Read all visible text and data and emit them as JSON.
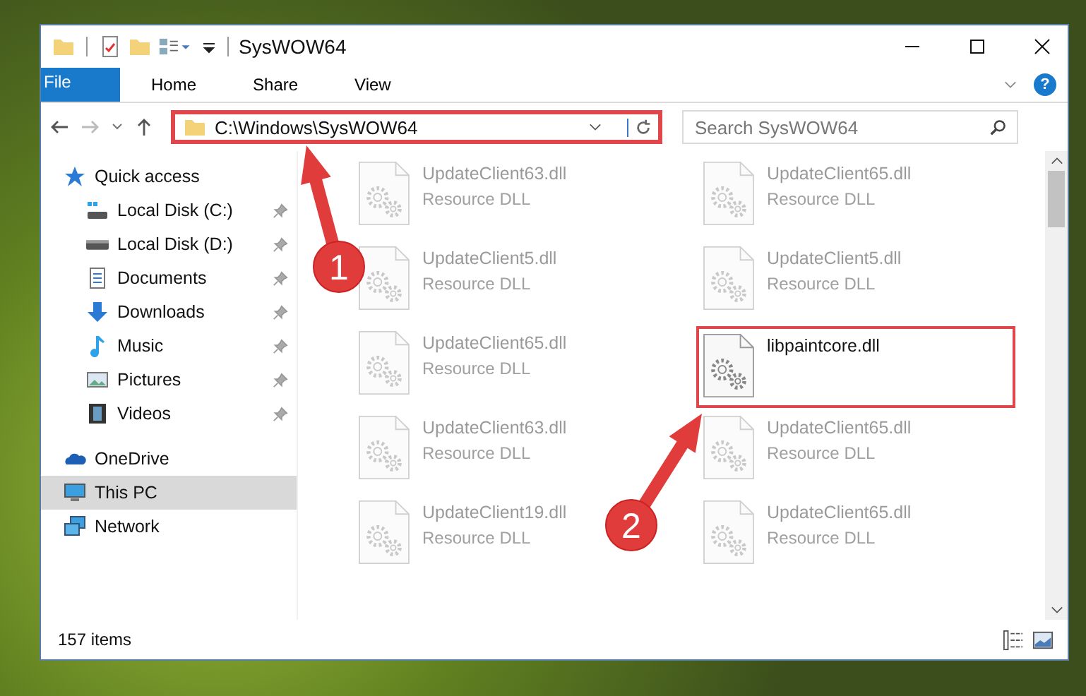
{
  "window": {
    "title": "SysWOW64"
  },
  "ribbon_tabs": [
    {
      "label": "File",
      "kind": "file"
    },
    {
      "label": "Home",
      "kind": "tab"
    },
    {
      "label": "Share",
      "kind": "tab"
    },
    {
      "label": "View",
      "kind": "tab"
    }
  ],
  "help_button": "?",
  "address_bar": {
    "path": "C:\\Windows\\SysWOW64",
    "highlighted": true
  },
  "search": {
    "placeholder": "Search SysWOW64"
  },
  "sidebar": {
    "items": [
      {
        "label": "Quick access",
        "kind": "star",
        "selected": false,
        "children": [
          {
            "label": "Local Disk (C:)",
            "kind": "system-drive",
            "pinned": true
          },
          {
            "label": "Local Disk (D:)",
            "kind": "drive",
            "pinned": true
          },
          {
            "label": "Documents",
            "kind": "documents",
            "pinned": true
          },
          {
            "label": "Downloads",
            "kind": "downloads",
            "pinned": true
          },
          {
            "label": "Music",
            "kind": "music",
            "pinned": true
          },
          {
            "label": "Pictures",
            "kind": "pictures",
            "pinned": true
          },
          {
            "label": "Videos",
            "kind": "videos",
            "pinned": true
          }
        ]
      },
      {
        "label": "OneDrive",
        "kind": "cloud",
        "selected": false
      },
      {
        "label": "This PC",
        "kind": "computer",
        "selected": true
      },
      {
        "label": "Network",
        "kind": "network",
        "selected": false
      }
    ]
  },
  "files": [
    {
      "name": "UpdateClient63.dll",
      "type": "Resource DLL",
      "faded": true,
      "highlighted": false
    },
    {
      "name": "UpdateClient65.dll",
      "type": "Resource DLL",
      "faded": true,
      "highlighted": false
    },
    {
      "name": "UpdateClient5.dll",
      "type": "Resource DLL",
      "faded": true,
      "highlighted": false
    },
    {
      "name": "UpdateClient5.dll",
      "type": "Resource DLL",
      "faded": true,
      "highlighted": false
    },
    {
      "name": "UpdateClient65.dll",
      "type": "Resource DLL",
      "faded": true,
      "highlighted": false
    },
    {
      "name": "libpaintcore.dll",
      "faded": false,
      "highlighted": true
    },
    {
      "name": "UpdateClient63.dll",
      "type": "Resource DLL",
      "faded": true,
      "highlighted": false
    },
    {
      "name": "UpdateClient65.dll",
      "type": "Resource DLL",
      "faded": true,
      "highlighted": false
    },
    {
      "name": "UpdateClient19.dll",
      "type": "Resource DLL",
      "faded": true,
      "highlighted": false
    },
    {
      "name": "UpdateClient65.dll",
      "type": "Resource DLL",
      "faded": true,
      "highlighted": false
    }
  ],
  "status_bar": {
    "item_count": "157 items"
  },
  "annotations": [
    {
      "label": "1"
    },
    {
      "label": "2"
    }
  ]
}
